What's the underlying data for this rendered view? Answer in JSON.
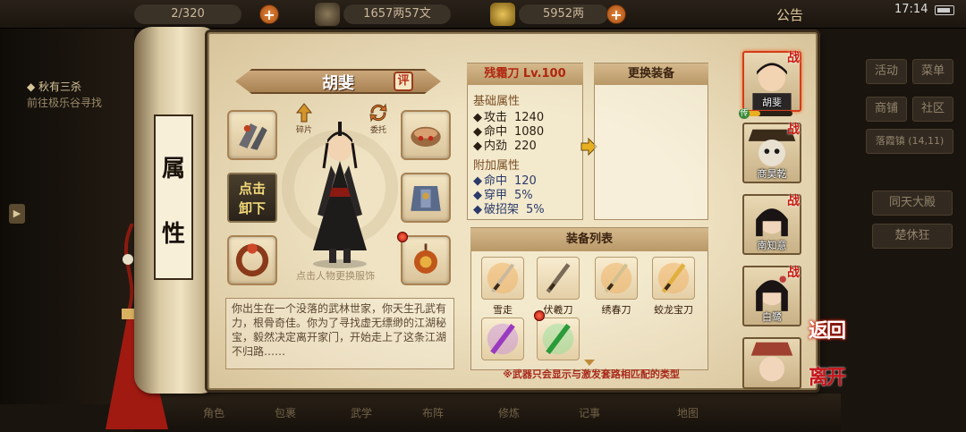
{
  "topbar": {
    "capacity": "2/320",
    "copper": "1657两57文",
    "silver": "5952两",
    "announcement": "公告",
    "time": "17:14"
  },
  "quest": {
    "title": "◆ 秋有三杀",
    "desc": "前往极乐谷寻找"
  },
  "scroll": {
    "char1": "属",
    "char2": "性"
  },
  "hero": {
    "name": "胡斐",
    "review_label": "评",
    "fragment_label": "碎片",
    "delegate_label": "委托",
    "unequip_label_1": "点击",
    "unequip_label_2": "卸下",
    "hint": "点击人物更换服饰",
    "description": "你出生在一个没落的武林世家，你天生孔武有力，根骨奇佳。你为了寻找虚无缥缈的江湖秘宝，毅然决定离开家门，开始走上了这条江湖不归路……"
  },
  "weapon": {
    "title": "残霜刀 Lv.100",
    "base_header": "基础属性",
    "base": [
      {
        "name": "攻击",
        "value": "1240"
      },
      {
        "name": "命中",
        "value": "1080"
      },
      {
        "name": "内劲",
        "value": "220"
      }
    ],
    "extra_header": "附加属性",
    "extra": [
      {
        "name": "命中",
        "value": "120"
      },
      {
        "name": "穿甲",
        "value": "5%"
      },
      {
        "name": "破招架",
        "value": "5%"
      }
    ]
  },
  "replace": {
    "title": "更换装备"
  },
  "equip_list": {
    "title": "装备列表",
    "items": [
      {
        "label": "雪走",
        "color": "#c8b8a0"
      },
      {
        "label": "伏羲刀",
        "color": "#7a6a58"
      },
      {
        "label": "绣春刀",
        "color": "#d0c090"
      },
      {
        "label": "蛟龙宝刀",
        "color": "#e0b040"
      },
      {
        "label": "",
        "color": "#9a3ac0"
      },
      {
        "label": "",
        "color": "#2a9a3a"
      }
    ],
    "note": "※武器只会显示与激发套路相匹配的类型"
  },
  "roster": [
    {
      "name": "胡斐",
      "badge": "战",
      "level_tag": "传"
    },
    {
      "name": "商昊乾",
      "badge": "战"
    },
    {
      "name": "南知意",
      "badge": "战"
    },
    {
      "name": "白鹭",
      "badge": "战"
    },
    {
      "name": "",
      "badge": ""
    }
  ],
  "right_menu": {
    "activity": "活动",
    "menu": "菜单",
    "shop": "商铺",
    "community": "社区",
    "location": "落霞镇",
    "coords": "(14,11)",
    "btn1": "同天大殿",
    "btn2": "楚休狂",
    "back": "返回",
    "leave": "离开"
  },
  "dock": [
    "角色",
    "包裹",
    "武学",
    "布阵",
    "修炼",
    "记事",
    "地图"
  ]
}
